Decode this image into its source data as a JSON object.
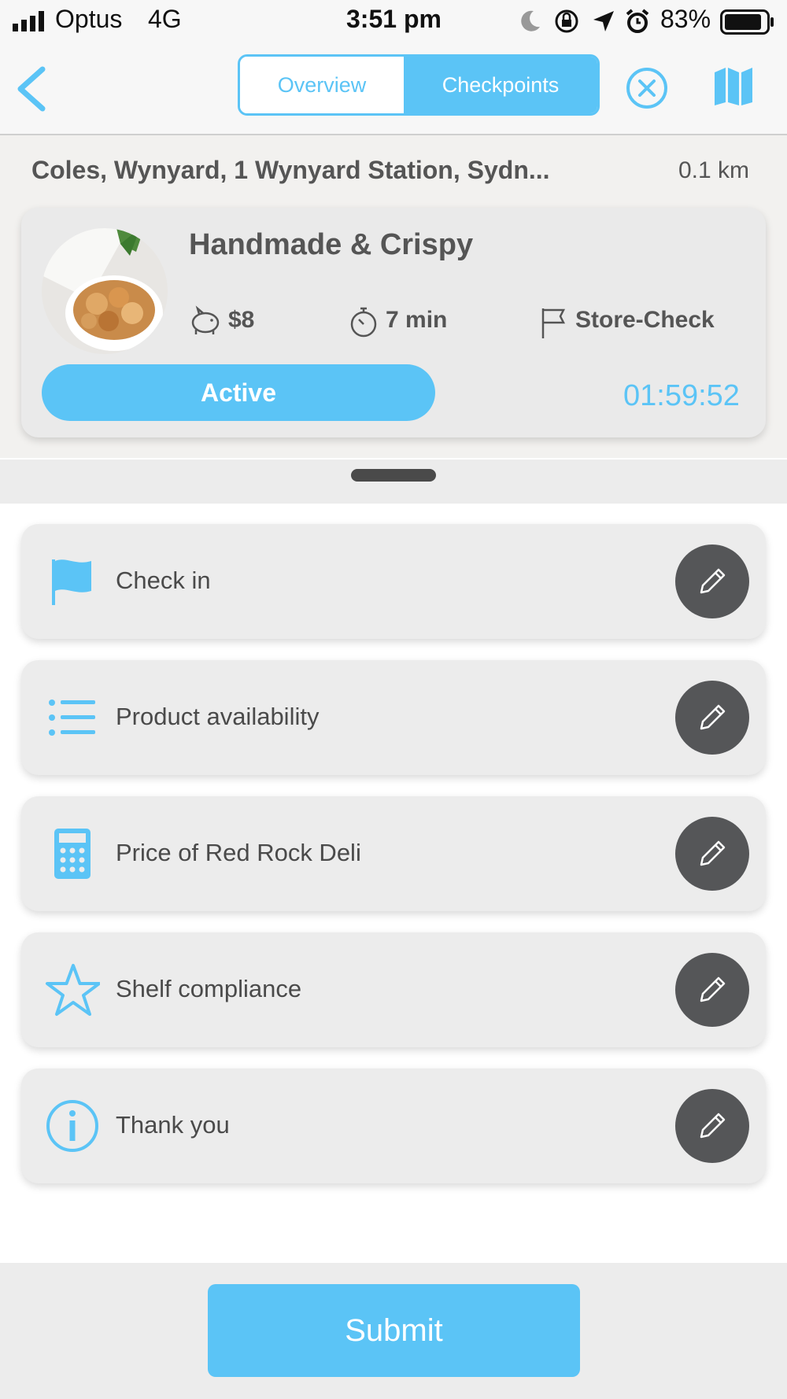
{
  "status_bar": {
    "carrier": "Optus",
    "network": "4G",
    "time": "3:51 pm",
    "battery": "83%"
  },
  "nav": {
    "tabs": [
      "Overview",
      "Checkpoints"
    ],
    "selected_tab": "Checkpoints"
  },
  "job": {
    "address": "Coles, Wynyard, 1 Wynyard Station, Sydn...",
    "distance": "0.1 km",
    "title": "Handmade & Crispy",
    "reward": "$8",
    "duration": "7 min",
    "type": "Store-Check",
    "status": "Active",
    "countdown": "01:59:52"
  },
  "checkpoints": [
    {
      "label": "Check in",
      "icon": "flag-icon"
    },
    {
      "label": "Product availability",
      "icon": "list-icon"
    },
    {
      "label": "Price of Red Rock Deli",
      "icon": "calculator-icon"
    },
    {
      "label": "Shelf compliance",
      "icon": "star-icon"
    },
    {
      "label": "Thank you",
      "icon": "info-icon"
    }
  ],
  "footer": {
    "submit_label": "Submit"
  },
  "colors": {
    "accent": "#5bc4f6",
    "edit_button": "#555658",
    "text": "#4a4a4a"
  }
}
